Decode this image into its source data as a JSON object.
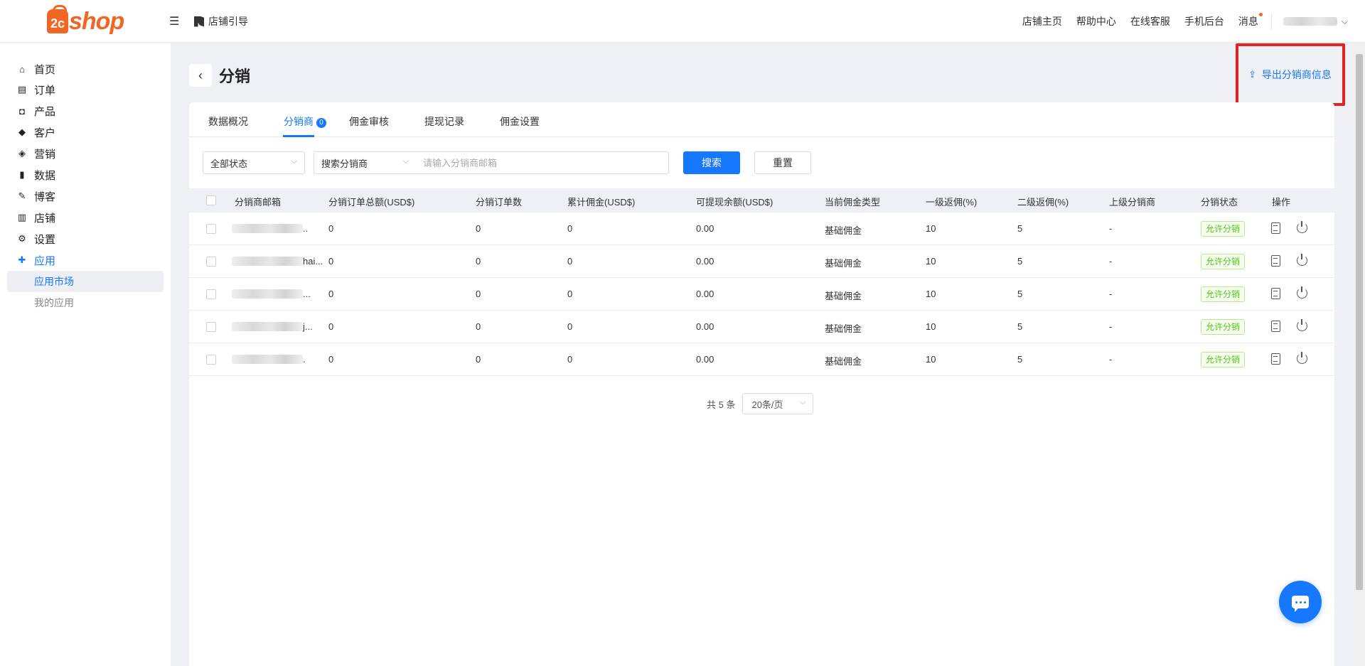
{
  "header": {
    "logo_prefix": "2c",
    "logo_text": "shop",
    "guide_label": "店铺引导",
    "links": [
      "店铺主页",
      "帮助中心",
      "在线客服",
      "手机后台",
      "消息"
    ]
  },
  "sidebar": {
    "items": [
      {
        "label": "首页",
        "icon": "home-icon"
      },
      {
        "label": "订单",
        "icon": "clipboard-icon"
      },
      {
        "label": "产品",
        "icon": "bag-icon"
      },
      {
        "label": "客户",
        "icon": "diamond-icon"
      },
      {
        "label": "营销",
        "icon": "tag-icon"
      },
      {
        "label": "数据",
        "icon": "bar-chart-icon"
      },
      {
        "label": "博客",
        "icon": "edit-icon"
      },
      {
        "label": "店铺",
        "icon": "store-icon"
      },
      {
        "label": "设置",
        "icon": "gear-icon"
      },
      {
        "label": "应用",
        "icon": "puzzle-icon"
      }
    ],
    "sub_items": [
      {
        "label": "应用市场"
      },
      {
        "label": "我的应用"
      }
    ]
  },
  "page": {
    "title": "分销",
    "export_label": "导出分销商信息"
  },
  "tabs": [
    {
      "label": "数据概况"
    },
    {
      "label": "分销商",
      "badge": "0"
    },
    {
      "label": "佣金审核"
    },
    {
      "label": "提现记录"
    },
    {
      "label": "佣金设置"
    }
  ],
  "filters": {
    "status_value": "全部状态",
    "search_type_value": "搜索分销商",
    "search_placeholder": "请输入分销商邮箱",
    "search_button": "搜索",
    "reset_button": "重置"
  },
  "table": {
    "columns": [
      "分销商邮箱",
      "分销订单总额(USD$)",
      "分销订单数",
      "累计佣金(USD$)",
      "可提现余额(USD$)",
      "当前佣金类型",
      "一级返佣(%)",
      "二级返佣(%)",
      "上级分销商",
      "分销状态",
      "操作"
    ],
    "rows": [
      {
        "email_tail": "..",
        "order_total": "0",
        "order_count": "0",
        "commission": "0",
        "balance": "0.00",
        "type": "基础佣金",
        "level1": "10",
        "level2": "5",
        "parent": "-",
        "status": "允许分销"
      },
      {
        "email_tail": "hai...",
        "order_total": "0",
        "order_count": "0",
        "commission": "0",
        "balance": "0.00",
        "type": "基础佣金",
        "level1": "10",
        "level2": "5",
        "parent": "-",
        "status": "允许分销"
      },
      {
        "email_tail": "...",
        "order_total": "0",
        "order_count": "0",
        "commission": "0",
        "balance": "0.00",
        "type": "基础佣金",
        "level1": "10",
        "level2": "5",
        "parent": "-",
        "status": "允许分销"
      },
      {
        "email_tail": "j...",
        "order_total": "0",
        "order_count": "0",
        "commission": "0",
        "balance": "0.00",
        "type": "基础佣金",
        "level1": "10",
        "level2": "5",
        "parent": "-",
        "status": "允许分销"
      },
      {
        "email_tail": ".",
        "order_total": "0",
        "order_count": "0",
        "commission": "0",
        "balance": "0.00",
        "type": "基础佣金",
        "level1": "10",
        "level2": "5",
        "parent": "-",
        "status": "允许分销"
      }
    ]
  },
  "pagination": {
    "total_label": "共 5 条",
    "page_size": "20条/页"
  },
  "colors": {
    "accent": "#1677ff",
    "brand": "#f26522",
    "highlight_box": "#e52222",
    "status_green": "#52c41a"
  }
}
